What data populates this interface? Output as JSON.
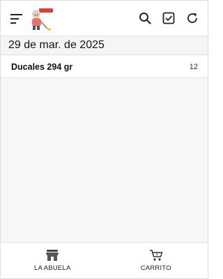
{
  "header": {
    "icons": [
      "menu-icon",
      "logo-grandma",
      "search-icon",
      "checkbox-icon",
      "refresh-icon"
    ],
    "logo_badge": "LA ABUELA"
  },
  "date_label": "29 de mar. de 2025",
  "list": {
    "items": [
      {
        "name": "Ducales 294 gr",
        "count": "12"
      }
    ]
  },
  "bottom_nav": {
    "items": [
      {
        "label": "LA ABUELA",
        "icon": "store-icon"
      },
      {
        "label": "CARRITO",
        "icon": "cart-icon"
      }
    ]
  },
  "colors": {
    "background": "#f7f7f8",
    "surface": "#ffffff",
    "text": "#111111",
    "accent_red": "#e53935"
  }
}
